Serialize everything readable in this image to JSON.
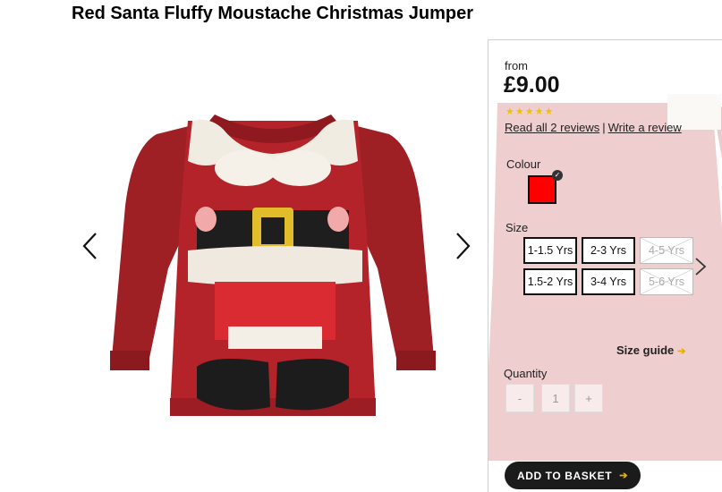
{
  "product": {
    "title": "Red Santa Fluffy Moustache Christmas Jumper",
    "price_prefix": "from",
    "price": "£9.00",
    "rating_stars": 5,
    "reviews_link": "Read all 2 reviews",
    "reviews_separator": "|",
    "write_review_link": "Write a review"
  },
  "gallery": {
    "prev_icon": "chevron-left-icon",
    "next_icon": "chevron-right-icon"
  },
  "options": {
    "colour_label": "Colour",
    "selected_colour": "#ff0000",
    "size_label": "Size",
    "sizes": [
      {
        "label": "1-1.5 Yrs",
        "available": true
      },
      {
        "label": "2-3 Yrs",
        "available": true
      },
      {
        "label": "4-5 Yrs",
        "available": false
      },
      {
        "label": "1.5-2 Yrs",
        "available": true
      },
      {
        "label": "3-4 Yrs",
        "available": true
      },
      {
        "label": "5-6 Yrs",
        "available": false
      }
    ],
    "size_guide": "Size guide"
  },
  "quantity": {
    "label": "Quantity",
    "minus": "-",
    "value": "1",
    "plus": "+"
  },
  "actions": {
    "add_to_basket": "ADD TO BASKET"
  },
  "colors": {
    "accent_arrow": "#e3b000",
    "button_bg": "#1b1b1b",
    "star": "#f2c200"
  }
}
